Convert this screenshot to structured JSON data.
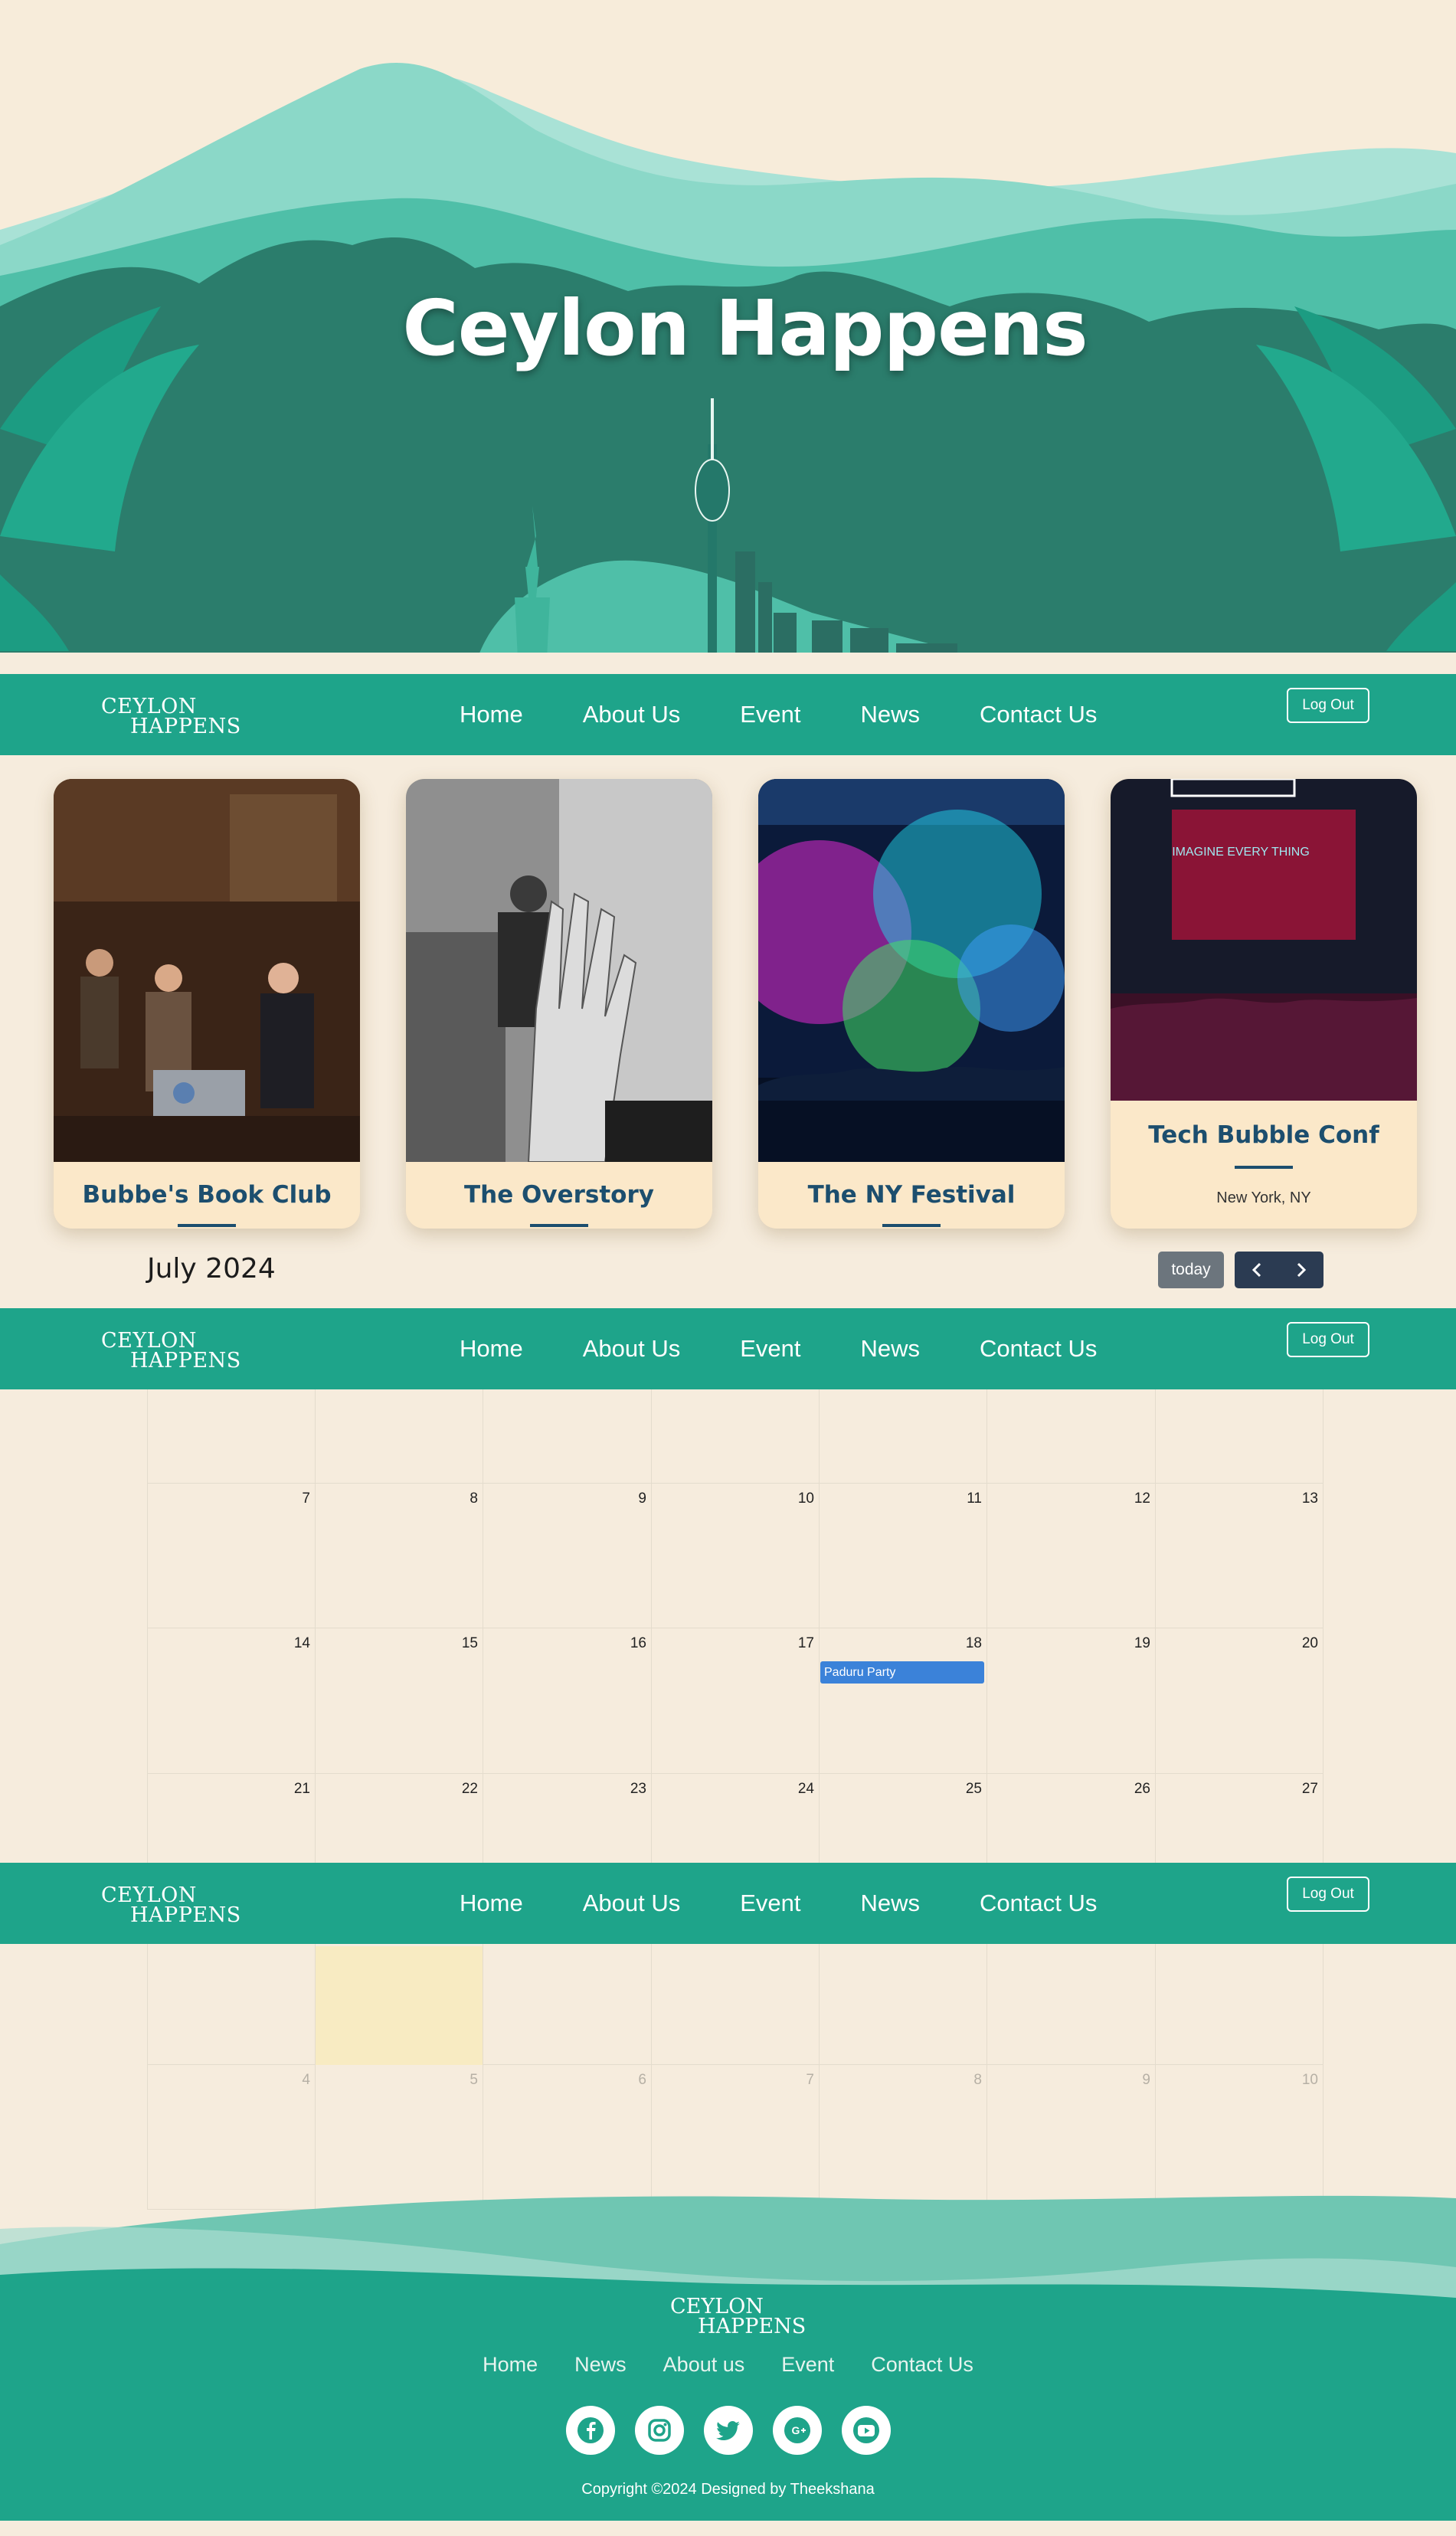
{
  "hero": {
    "title": "Ceylon Happens"
  },
  "nav": {
    "logo_line1": "CEYLON",
    "logo_line2": "HAPPENS",
    "links": [
      "Home",
      "About Us",
      "Event",
      "News",
      "Contact Us"
    ],
    "logout_label": "Log Out"
  },
  "cards": [
    {
      "title": "Bubbe's Book Club",
      "location": ""
    },
    {
      "title": "The Overstory",
      "location": ""
    },
    {
      "title": "The NY Festival",
      "location": ""
    },
    {
      "title": "Tech Bubble Conf",
      "location": "New York, NY",
      "screen_text": "IMAGINE EVERY THING"
    }
  ],
  "calendar": {
    "title": "July 2024",
    "today_label": "today",
    "prev_icon": "chevron-left-icon",
    "next_icon": "chevron-right-icon",
    "weeks": [
      [
        "7",
        "8",
        "9",
        "10",
        "11",
        "12",
        "13"
      ],
      [
        "14",
        "15",
        "16",
        "17",
        "18",
        "19",
        "20"
      ],
      [
        "21",
        "22",
        "23",
        "24",
        "25",
        "26",
        "27"
      ],
      [
        "4",
        "5",
        "6",
        "7",
        "8",
        "9",
        "10"
      ]
    ],
    "event": {
      "title": "Paduru Party",
      "date": "18",
      "color": "#3b82d9"
    }
  },
  "footer": {
    "logo_line1": "CEYLON",
    "logo_line2": "HAPPENS",
    "links": [
      "Home",
      "News",
      "About us",
      "Event",
      "Contact Us"
    ],
    "socials": [
      "facebook-icon",
      "instagram-icon",
      "twitter-icon",
      "google-plus-icon",
      "youtube-icon"
    ],
    "copyright": "Copyright ©2024 Designed by Theekshana"
  },
  "colors": {
    "primary": "#1ea48a",
    "heading_blue": "#1c4e6e",
    "background": "#f6ecdd",
    "card_bg": "#fbe8c9"
  }
}
